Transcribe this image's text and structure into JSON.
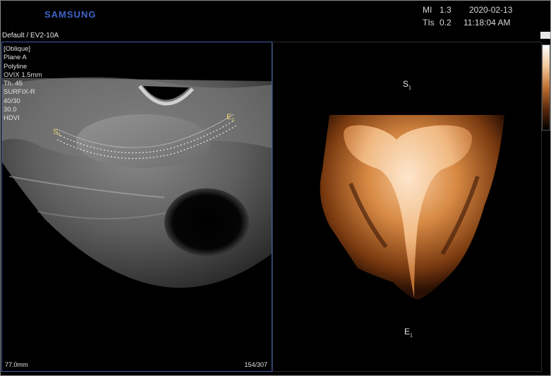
{
  "header": {
    "logo": "SAMSUNG",
    "mi_label": "MI",
    "mi_value": "1.3",
    "tis_label": "TIs",
    "tis_value": "0.2",
    "date": "2020-02-13",
    "time": "11:18:04 AM",
    "preset": "Default / EV2-10A"
  },
  "left_panel": {
    "params": [
      "[Oblique]",
      "Plane A",
      "Polyline",
      "OVIX 1.5mm",
      "Th. 45",
      "SURFIX-R",
      "40/30",
      "30.0",
      "HDVI"
    ],
    "start_marker": "S",
    "end_marker": "E",
    "marker_sub": "1",
    "depth": "77.0mm",
    "frame_count": "154/307"
  },
  "right_panel": {
    "top_marker": "S",
    "bottom_marker": "E",
    "marker_sub": "1"
  },
  "colors": {
    "accent_blue": "#3d64c8",
    "panel_border": "#3f5fa6",
    "marker_yellow": "#f0d070",
    "render_orange": "#c8742e"
  }
}
